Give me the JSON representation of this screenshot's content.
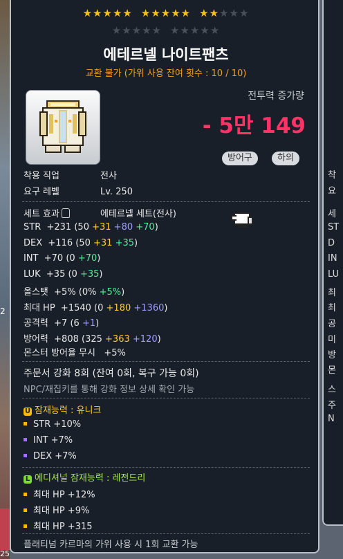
{
  "background": {
    "left_number_1": "2",
    "left_number_2": "25"
  },
  "stars": {
    "total": 25,
    "filled": 12
  },
  "item": {
    "name": "에테르넬 나이트팬츠",
    "trade_info": "교환 불가 (가위 사용 잔여 횟수 : 10 / 10)",
    "icon_name": "pants-icon"
  },
  "combat_power": {
    "label": "전투력 증가량",
    "value": "- 5만 149"
  },
  "badges": [
    "방어구",
    "하의"
  ],
  "requirements": {
    "job_key": "착용 직업",
    "job_value": "전사",
    "level_key": "요구 레벨",
    "level_value": "Lv. 250"
  },
  "set_effect": {
    "key": "세트 효과",
    "value": "에테르넬 세트(전사)"
  },
  "stats": [
    {
      "name": "STR",
      "total": "+231",
      "base": "50",
      "yellow": "+31",
      "blue": "+80",
      "green": "+70"
    },
    {
      "name": "DEX",
      "total": "+116",
      "base": "50",
      "yellow": "+31",
      "green": "+35"
    },
    {
      "name": "INT",
      "total": "+70",
      "base": "0",
      "green": "+70"
    },
    {
      "name": "LUK",
      "total": "+35",
      "base": "0",
      "green": "+35"
    },
    {
      "name": "올스탯",
      "total": "+5%",
      "base": "0%",
      "green": "+5%"
    },
    {
      "name": "최대 HP",
      "total": "+1540",
      "base": "0",
      "yellow": "+180",
      "blue": "+1360"
    },
    {
      "name": "공격력",
      "total": "+7",
      "base": "6",
      "blue": "+1"
    },
    {
      "name": "방어력",
      "total": "+808",
      "base": "325",
      "yellow": "+363",
      "blue": "+120"
    }
  ],
  "ignore_def": {
    "name": "몬스터 방어율 무시",
    "value": "+5%"
  },
  "scroll": {
    "text": "주문서 강화 8회 (잔여 0회, 복구 가능 0회)",
    "hint": "NPC/재집키를 통해 강화 정보 상세 확인 가능"
  },
  "potential": {
    "badge": "U",
    "title": "잠재능력 : 유니크",
    "lines": [
      "STR +10%",
      "INT +7%",
      "DEX +7%"
    ]
  },
  "additional_potential": {
    "badge": "L",
    "title": "에디셔널 잠재능력 : 레전드리",
    "lines": [
      "최대 HP +12%",
      "최대 HP +9%",
      "최대 HP +315"
    ]
  },
  "footer": "플래티넘 카르마의 가위 사용 시 1회 교환 가능",
  "side_tooltip": {
    "chars": [
      "착",
      "요",
      "세",
      "ST",
      "D",
      "IN",
      "LU",
      "최",
      "최",
      "공",
      "미",
      "방",
      "몬",
      "스",
      "주",
      "N"
    ]
  },
  "colors": {
    "star": "#f6c11b",
    "combat_power": "#ff3366",
    "trade": "#f0a020",
    "yellow_stat": "#ffcc33",
    "blue_stat": "#9fa0ff",
    "green_stat": "#55ee99"
  }
}
